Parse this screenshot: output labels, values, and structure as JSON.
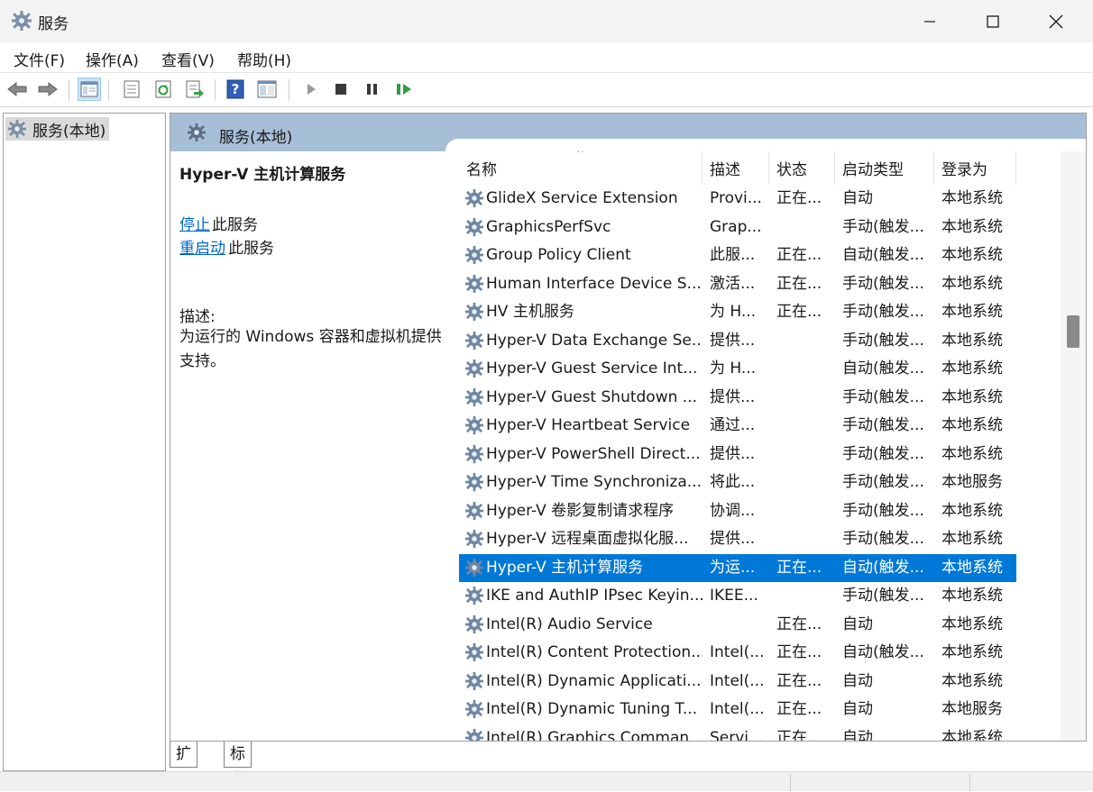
{
  "window": {
    "title": "服务"
  },
  "menu": [
    "文件(F)",
    "操作(A)",
    "查看(V)",
    "帮助(H)"
  ],
  "toolbar": {
    "buttons": [
      "back-icon",
      "forward-icon",
      "show-hide-console-tree-icon",
      "properties-icon",
      "refresh-icon",
      "export-list-icon",
      "help-icon",
      "console-icon",
      "start-service-icon",
      "stop-service-icon",
      "pause-service-icon",
      "restart-service-icon"
    ]
  },
  "tree": {
    "root_label": "服务(本地)"
  },
  "details": {
    "header_title": "服务(本地)",
    "service_name": "Hyper-V 主机计算服务",
    "stop_link": "停止",
    "stop_suffix": "此服务",
    "restart_link": "重启动",
    "restart_suffix": "此服务",
    "desc_label": "描述:",
    "desc_text": "为运行的 Windows 容器和虚拟机提供支持。"
  },
  "columns": [
    "名称",
    "描述",
    "状态",
    "启动类型",
    "登录为"
  ],
  "services": [
    [
      "GlideX Service Extension",
      "Provi...",
      "正在...",
      "自动",
      "本地系统"
    ],
    [
      "GraphicsPerfSvc",
      "Grap...",
      "",
      "手动(触发...",
      "本地系统"
    ],
    [
      "Group Policy Client",
      "此服...",
      "正在...",
      "自动(触发...",
      "本地系统"
    ],
    [
      "Human Interface Device S...",
      "激活...",
      "正在...",
      "手动(触发...",
      "本地系统"
    ],
    [
      "HV 主机服务",
      "为 H...",
      "正在...",
      "手动(触发...",
      "本地系统"
    ],
    [
      "Hyper-V Data Exchange Se...",
      "提供...",
      "",
      "手动(触发...",
      "本地系统"
    ],
    [
      "Hyper-V Guest Service Int...",
      "为 H...",
      "",
      "自动(触发...",
      "本地系统"
    ],
    [
      "Hyper-V Guest Shutdown ...",
      "提供...",
      "",
      "手动(触发...",
      "本地系统"
    ],
    [
      "Hyper-V Heartbeat Service",
      "通过...",
      "",
      "手动(触发...",
      "本地系统"
    ],
    [
      "Hyper-V PowerShell Direct...",
      "提供...",
      "",
      "手动(触发...",
      "本地系统"
    ],
    [
      "Hyper-V Time Synchroniza...",
      "将此...",
      "",
      "手动(触发...",
      "本地服务"
    ],
    [
      "Hyper-V 卷影复制请求程序",
      "协调...",
      "",
      "手动(触发...",
      "本地系统"
    ],
    [
      "Hyper-V 远程桌面虚拟化服...",
      "提供...",
      "",
      "手动(触发...",
      "本地系统"
    ],
    [
      "Hyper-V 主机计算服务",
      "为运...",
      "正在...",
      "自动(触发...",
      "本地系统"
    ],
    [
      "IKE and AuthIP IPsec Keyin...",
      "IKEE...",
      "",
      "手动(触发...",
      "本地系统"
    ],
    [
      "Intel(R) Audio Service",
      "",
      "正在...",
      "自动",
      "本地系统"
    ],
    [
      "Intel(R) Content Protection...",
      "Intel(...",
      "正在...",
      "自动(触发...",
      "本地系统"
    ],
    [
      "Intel(R) Dynamic Applicati...",
      "Intel(...",
      "正在...",
      "自动",
      "本地系统"
    ],
    [
      "Intel(R) Dynamic Tuning T...",
      "Intel(...",
      "正在...",
      "自动",
      "本地服务"
    ],
    [
      "Intel(R) Graphics Comman...",
      "Servi...",
      "正在...",
      "自动",
      "本地系统"
    ]
  ],
  "selected_index": 13,
  "tabs": [
    "扩展",
    "标准"
  ],
  "colors": {
    "selection": "#0078d7",
    "header_band": "#a7bed7",
    "link": "#0066cc"
  }
}
